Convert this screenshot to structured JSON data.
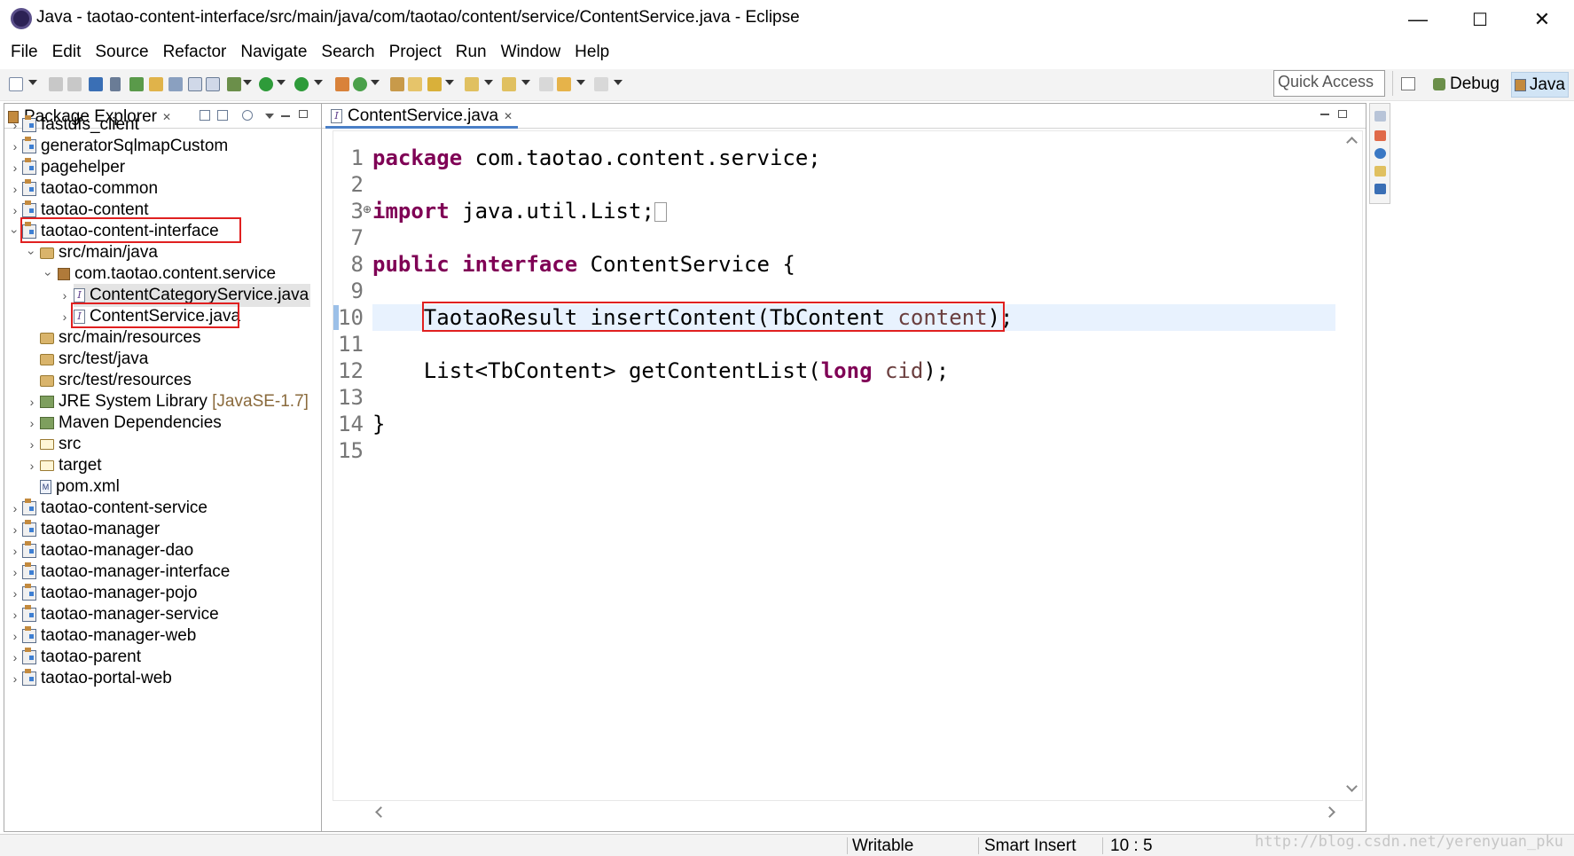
{
  "window": {
    "title": "Java - taotao-content-interface/src/main/java/com/taotao/content/service/ContentService.java - Eclipse",
    "minimize": "—",
    "maximize": "☐",
    "close": "✕"
  },
  "menu": [
    "File",
    "Edit",
    "Source",
    "Refactor",
    "Navigate",
    "Search",
    "Project",
    "Run",
    "Window",
    "Help"
  ],
  "toolbar": {
    "quick_access_placeholder": "Quick Access",
    "debug_label": "Debug",
    "java_label": "Java"
  },
  "package_explorer": {
    "title": "Package Explorer",
    "close": "✕",
    "tree": [
      {
        "label": "fastdfs_client",
        "expanded": false
      },
      {
        "label": "generatorSqlmapCustom",
        "expanded": false
      },
      {
        "label": "pagehelper",
        "expanded": false
      },
      {
        "label": "taotao-common",
        "expanded": false
      },
      {
        "label": "taotao-content",
        "expanded": false
      },
      {
        "label": "taotao-content-interface",
        "expanded": true,
        "highlighted": true
      },
      {
        "label": "src/main/java",
        "expanded": true
      },
      {
        "label": "com.taotao.content.service",
        "expanded": true
      },
      {
        "label": "ContentCategoryService.java",
        "selected": true
      },
      {
        "label": "ContentService.java",
        "highlighted": true
      },
      {
        "label": "src/main/resources"
      },
      {
        "label": "src/test/java"
      },
      {
        "label": "src/test/resources"
      },
      {
        "label": "JRE System Library",
        "suffix": "[JavaSE-1.7]"
      },
      {
        "label": "Maven Dependencies"
      },
      {
        "label": "src"
      },
      {
        "label": "target"
      },
      {
        "label": "pom.xml"
      },
      {
        "label": "taotao-content-service",
        "expanded": false
      },
      {
        "label": "taotao-manager",
        "expanded": false
      },
      {
        "label": "taotao-manager-dao",
        "expanded": false
      },
      {
        "label": "taotao-manager-interface",
        "expanded": false
      },
      {
        "label": "taotao-manager-pojo",
        "expanded": false
      },
      {
        "label": "taotao-manager-service",
        "expanded": false
      },
      {
        "label": "taotao-manager-web",
        "expanded": false
      },
      {
        "label": "taotao-parent",
        "expanded": false
      },
      {
        "label": "taotao-portal-web",
        "expanded": false
      }
    ]
  },
  "editor": {
    "tab_label": "ContentService.java",
    "tab_close": "✕",
    "folding_marker": "⊕",
    "line_numbers": [
      "1",
      "2",
      "3",
      "7",
      "8",
      "9",
      "10",
      "11",
      "12",
      "13",
      "14",
      "15"
    ],
    "code": {
      "l1_kw": "package",
      "l1_rest": " com.taotao.content.service;",
      "l3_kw": "import",
      "l3_rest": " java.util.List;",
      "l8_kw1": "public",
      "l8_kw2": "interface",
      "l8_rest": " ContentService {",
      "l10_a": "    TaotaoResult insertContent(TbContent ",
      "l10_param": "content",
      "l10_b": ");",
      "l12_a": "    List<TbContent> getContentList(",
      "l12_kw": "long",
      "l12_param": " cid",
      "l12_b": ");",
      "l14": "}"
    }
  },
  "status": {
    "writable": "Writable",
    "insert_mode": "Smart Insert",
    "position": "10 : 5"
  },
  "watermark": "http://blog.csdn.net/yerenyuan_pku",
  "colors": {
    "keyword": "#7f0055",
    "parameter": "#6a3e3e",
    "highlight_box": "#e02020",
    "current_line": "#e8f2fe",
    "active_perspective": "#d1e4f5"
  }
}
